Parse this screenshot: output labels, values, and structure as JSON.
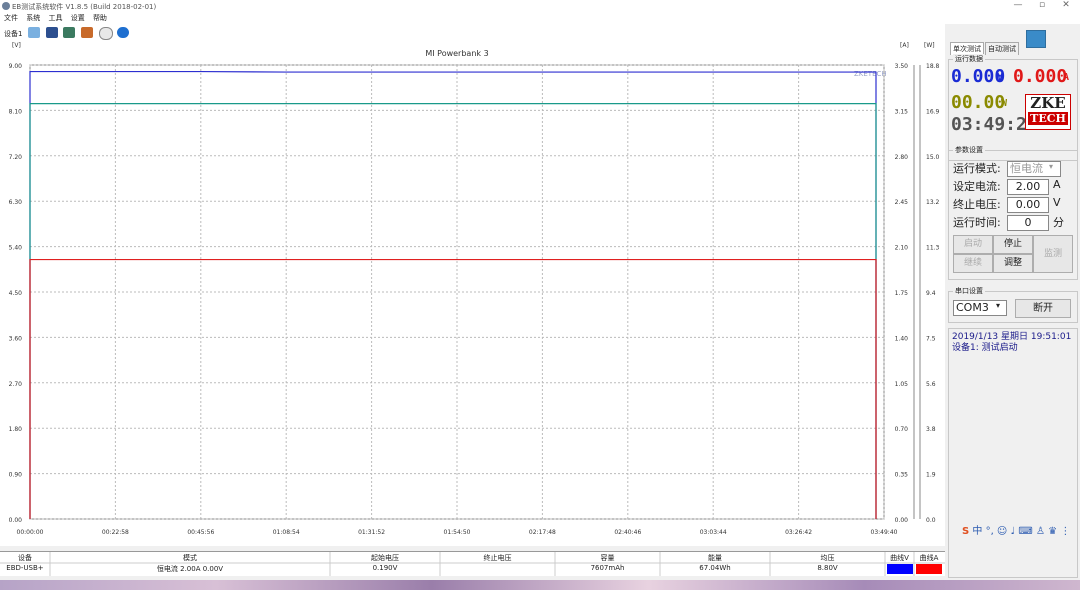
{
  "window": {
    "title": "EB测试系统软件 V1.8.5 (Build 2018-02-01)",
    "min": "—",
    "max": "▫",
    "close": "✕"
  },
  "menu": [
    "文件",
    "系统",
    "工具",
    "设置",
    "帮助"
  ],
  "toolbar": {
    "device_label": "设备1"
  },
  "chart": {
    "title": "MI Powerbank 3",
    "watermark": "ZKETECH",
    "left_unit": "[V]",
    "right_unit_a": "[A]",
    "right_unit_w": "[W]",
    "left_ticks": [
      "9.00",
      "8.10",
      "7.20",
      "6.30",
      "5.40",
      "4.50",
      "3.60",
      "2.70",
      "1.80",
      "0.90",
      "0.00"
    ],
    "a_ticks": [
      "3.50",
      "3.15",
      "2.80",
      "2.45",
      "2.10",
      "1.75",
      "1.40",
      "1.05",
      "0.70",
      "0.35",
      "0.00"
    ],
    "w_ticks": [
      "18.8",
      "16.9",
      "15.0",
      "13.2",
      "11.3",
      "9.4",
      "7.5",
      "5.6",
      "3.8",
      "1.9",
      "0.0"
    ],
    "x_ticks": [
      "00:00:00",
      "00:22:58",
      "00:45:56",
      "01:08:54",
      "01:31:52",
      "01:54:50",
      "02:17:48",
      "02:40:46",
      "03:03:44",
      "03:26:42",
      "03:49:40"
    ]
  },
  "chart_data": {
    "type": "line",
    "title": "MI Powerbank 3",
    "x": [
      "00:00:00",
      "00:22:58",
      "00:45:56",
      "01:08:54",
      "01:31:52",
      "01:54:50",
      "02:17:48",
      "02:40:46",
      "03:03:44",
      "03:26:42",
      "03:49:40"
    ],
    "series": [
      {
        "name": "V",
        "color": "#2d2fd0",
        "values": [
          8.87,
          8.87,
          8.87,
          8.86,
          8.86,
          8.86,
          8.86,
          8.86,
          8.86,
          8.86,
          8.86
        ]
      },
      {
        "name": "W",
        "color": "#1a9a8a",
        "values": [
          17.2,
          17.2,
          17.2,
          17.2,
          17.2,
          17.2,
          17.2,
          17.2,
          17.2,
          17.2,
          17.2
        ]
      },
      {
        "name": "A",
        "color": "#e02020",
        "values": [
          2.0,
          2.0,
          2.0,
          2.0,
          2.0,
          2.0,
          2.0,
          2.0,
          2.0,
          2.0,
          2.0
        ]
      }
    ],
    "ylim_v": [
      0,
      9
    ],
    "ylim_a": [
      0,
      3.5
    ],
    "ylim_w": [
      0,
      18.8
    ],
    "grid": true
  },
  "panel": {
    "tabs": [
      "单次测试",
      "自动测试"
    ],
    "run_data_title": "运行数据",
    "voltage": "0.000",
    "voltage_unit": "V",
    "current": "0.000",
    "current_unit": "A",
    "power": "00.00",
    "power_unit": "W",
    "time": "03:49:21",
    "logo_top": "ZKE",
    "logo_bottom": "TECH",
    "params_title": "参数设置",
    "mode_label": "运行模式:",
    "mode_value": "恒电流",
    "cur_label": "设定电流:",
    "cur_value": "2.00",
    "cur_unit": "A",
    "stop_label": "终止电压:",
    "stop_value": "0.00",
    "stop_unit": "V",
    "runtime_label": "运行时间:",
    "runtime_value": "0",
    "runtime_unit": "分",
    "btn_start": "启动",
    "btn_stop": "停止",
    "btn_continue": "继续",
    "btn_adjust": "调整",
    "btn_monitor": "监测",
    "serial_title": "串口设置",
    "com_value": "COM3",
    "btn_disconnect": "断开",
    "log_line1": "2019/1/13 星期日 19:51:01",
    "log_line2": "设备1: 测试启动"
  },
  "table": {
    "headers": [
      "设备",
      "模式",
      "起始电压",
      "终止电压",
      "容量",
      "能量",
      "均压",
      "曲线V",
      "曲线A"
    ],
    "row": [
      "EBD-USB+",
      "恒电流 2.00A 0.00V",
      "0.190V",
      "",
      "7607mAh",
      "67.04Wh",
      "8.80V",
      "",
      ""
    ],
    "curve_v_color": "#0000ff",
    "curve_a_color": "#ff0000"
  },
  "ime": "中 °, ☺ ♩ ⌨ ♙ ♛ ⋮"
}
